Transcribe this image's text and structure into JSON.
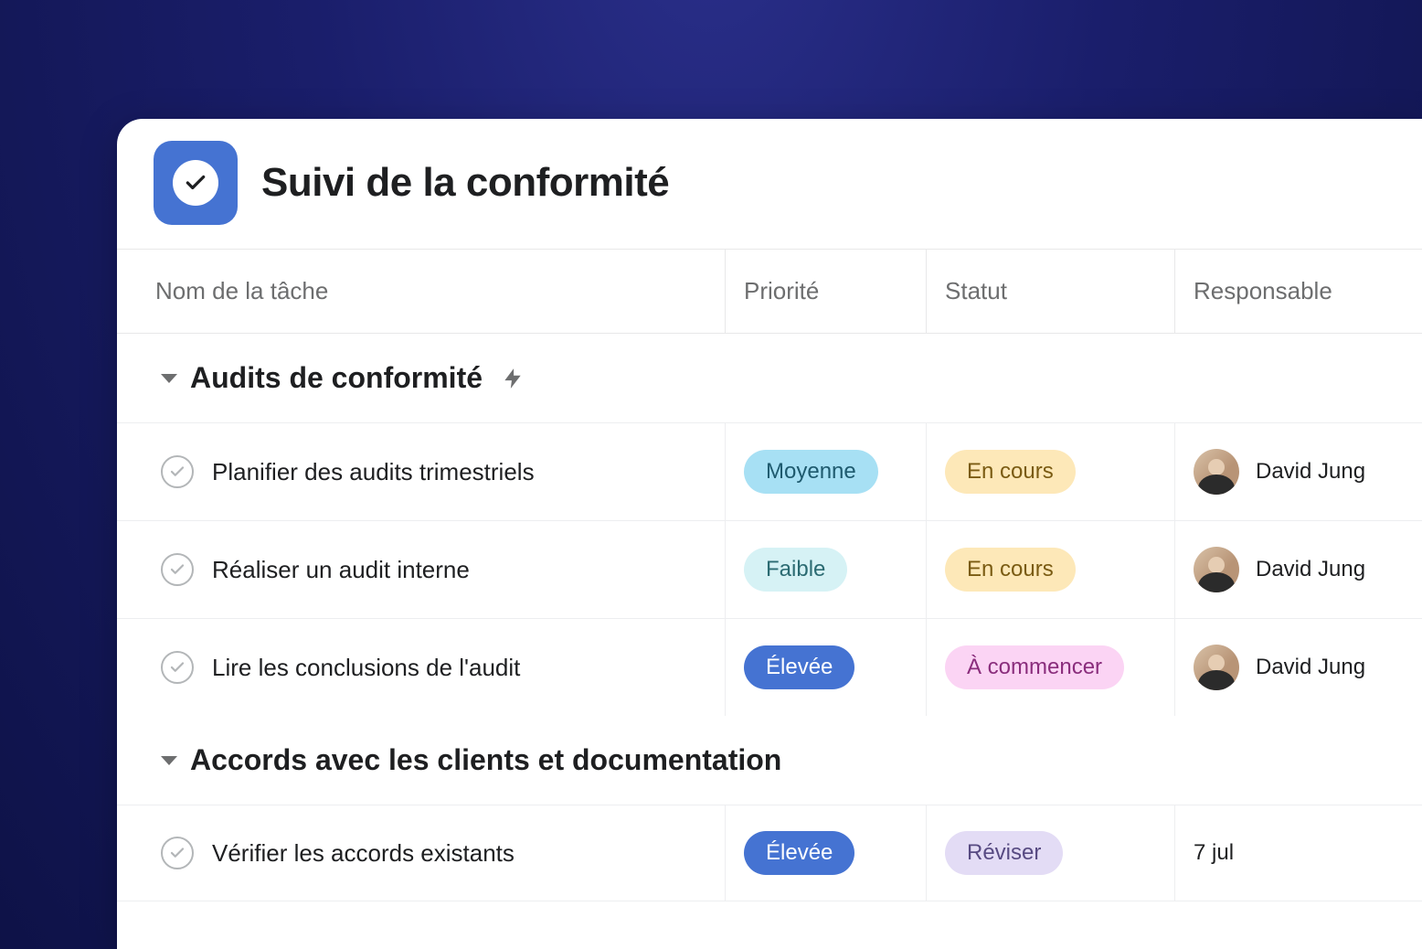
{
  "page": {
    "title": "Suivi de la conformité"
  },
  "columns": {
    "task": "Nom de la tâche",
    "priority": "Priorité",
    "status": "Statut",
    "responsible": "Responsable"
  },
  "sections": [
    {
      "title": "Audits de conformité",
      "has_bolt": true,
      "tasks": [
        {
          "name": "Planifier des audits trimestriels",
          "priority": "Moyenne",
          "priority_class": "moyenne",
          "status": "En cours",
          "status_class": "encours",
          "responsible": "David Jung"
        },
        {
          "name": "Réaliser un audit interne",
          "priority": "Faible",
          "priority_class": "faible",
          "status": "En cours",
          "status_class": "encours",
          "responsible": "David Jung"
        },
        {
          "name": "Lire les conclusions de l'audit",
          "priority": "Élevée",
          "priority_class": "elevee",
          "status": "À commencer",
          "status_class": "acommencer",
          "responsible": "David Jung"
        }
      ]
    },
    {
      "title": "Accords avec les clients et documentation",
      "has_bolt": false,
      "tasks": [
        {
          "name": "Vérifier les accords existants",
          "priority": "Élevée",
          "priority_class": "elevee",
          "status": "Réviser",
          "status_class": "reviser",
          "responsible_date": "7 jul"
        }
      ]
    }
  ]
}
